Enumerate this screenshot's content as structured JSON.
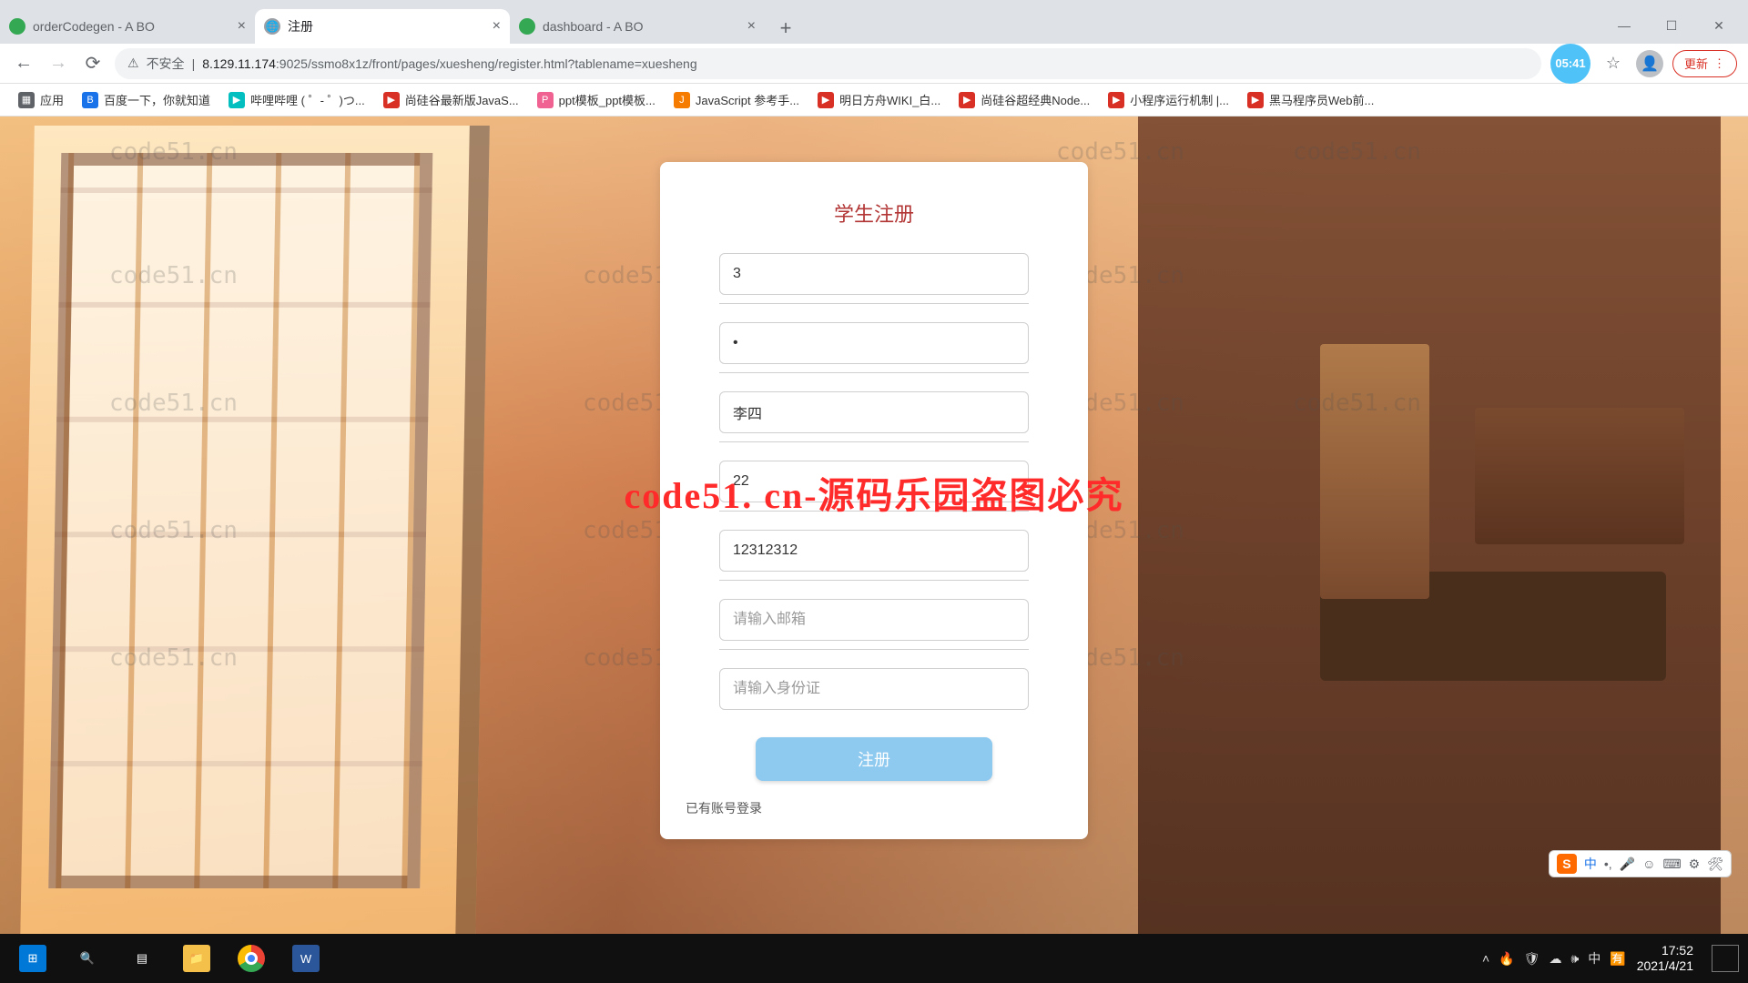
{
  "tabs": [
    {
      "title": "orderCodegen - A BO",
      "favicon": "green"
    },
    {
      "title": "注册",
      "favicon": "gray",
      "active": true
    },
    {
      "title": "dashboard - A BO",
      "favicon": "green"
    }
  ],
  "window_controls": {
    "min": "—",
    "max": "☐",
    "close": "✕"
  },
  "nav": {
    "back": "←",
    "forward": "→",
    "reload": "⟳"
  },
  "address": {
    "security_label": "不安全",
    "warn_glyph": "⚠",
    "host": "8.129.11.174",
    "port": ":9025",
    "path": "/ssmo8x1z/front/pages/xuesheng/register.html?tablename=xuesheng"
  },
  "badge_time": "05:41",
  "star_glyph": "☆",
  "profile_glyph": "👤",
  "update_label": "更新",
  "menu_glyph": "⋮",
  "bookmarks": {
    "apps": "应用",
    "items": [
      {
        "label": "百度一下，你就知道",
        "color": "blue"
      },
      {
        "label": "哔哩哔哩 ( ゜- ゜)つ...",
        "color": "teal"
      },
      {
        "label": "尚硅谷最新版JavaS...",
        "color": "red"
      },
      {
        "label": "ppt模板_ppt模板...",
        "color": "pink"
      },
      {
        "label": "JavaScript 参考手...",
        "color": "orange"
      },
      {
        "label": "明日方舟WIKI_白...",
        "color": "red"
      },
      {
        "label": "尚硅谷超经典Node...",
        "color": "red"
      },
      {
        "label": "小程序运行机制 |...",
        "color": "red"
      },
      {
        "label": "黑马程序员Web前...",
        "color": "red"
      }
    ]
  },
  "form": {
    "title": "学生注册",
    "username_value": "3",
    "password_value": "•",
    "name_value": "李四",
    "age_value": "22",
    "phone_value": "12312312",
    "email_placeholder": "请输入邮箱",
    "idcard_placeholder": "请输入身份证",
    "submit_label": "注册",
    "login_link": "已有账号登录"
  },
  "watermark_text": "code51.cn",
  "center_watermark": "code51. cn-源码乐园盗图必究",
  "ime": {
    "brand": "S",
    "lang": "中",
    "punct": "•,",
    "mic": "🎤",
    "face": "☺",
    "kb": "⌨",
    "gear": "⚙",
    "tool": "🛠"
  },
  "taskbar": {
    "tray": {
      "up": "˄",
      "flame": "🔥",
      "shield": "🛡",
      "cloud": "☁",
      "net": "🕪",
      "lang": "中",
      "ime": "🈶"
    },
    "time": "17:52",
    "date": "2021/4/21"
  }
}
